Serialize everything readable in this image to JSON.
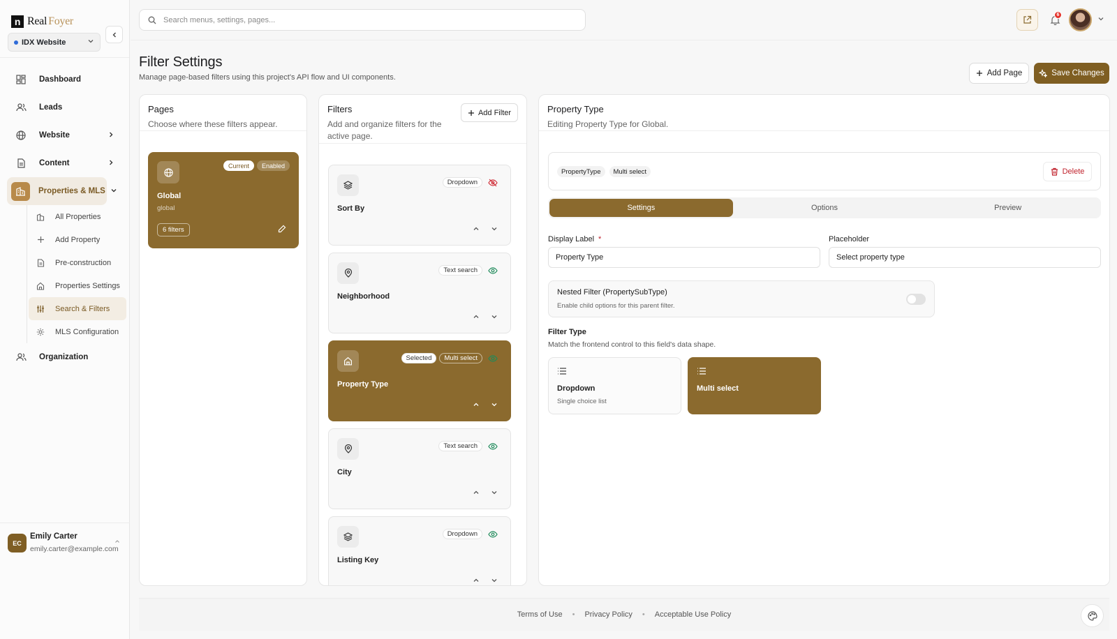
{
  "brand": {
    "logo_mark": "n",
    "name_a": "Real",
    "name_b": "Foyer"
  },
  "site_selector": {
    "value": "IDX Website"
  },
  "search": {
    "placeholder": "Search menus, settings, pages..."
  },
  "notifications": {
    "count": "6"
  },
  "nav": {
    "dashboard": "Dashboard",
    "leads": "Leads",
    "website": "Website",
    "content": "Content",
    "properties": "Properties & MLS",
    "organization": "Organization",
    "sub": {
      "all_properties": "All Properties",
      "add_property": "Add Property",
      "preconstruction": "Pre-construction",
      "properties_settings": "Properties Settings",
      "search_filters": "Search & Filters",
      "mls_configuration": "MLS Configuration"
    }
  },
  "user": {
    "initials": "EC",
    "name": "Emily Carter",
    "email": "emily.carter@example.com"
  },
  "page": {
    "title": "Filter Settings",
    "subtitle": "Manage page-based filters using this project's API flow and UI components.",
    "add_page": "Add Page",
    "save_changes": "Save Changes"
  },
  "pages_panel": {
    "title": "Pages",
    "desc": "Choose where these filters appear.",
    "card": {
      "badge_current": "Current",
      "badge_enabled": "Enabled",
      "name": "Global",
      "slug": "global",
      "count": "6 filters"
    }
  },
  "filters_panel": {
    "title": "Filters",
    "desc": "Add and organize filters for the active page.",
    "add_filter": "Add Filter",
    "items": [
      {
        "name": "Sort By",
        "type": "Dropdown",
        "selected_label": "",
        "icon": "layers-icon",
        "visible": false
      },
      {
        "name": "Neighborhood",
        "type": "Text search",
        "selected_label": "",
        "icon": "map-pin-icon",
        "visible": true
      },
      {
        "name": "Property Type",
        "type": "Multi select",
        "selected_label": "Selected",
        "icon": "home-icon",
        "visible": true
      },
      {
        "name": "City",
        "type": "Text search",
        "selected_label": "",
        "icon": "map-pin-icon",
        "visible": true
      },
      {
        "name": "Listing Key",
        "type": "Dropdown",
        "selected_label": "",
        "icon": "layers-icon",
        "visible": true
      }
    ]
  },
  "editor": {
    "title": "Property Type",
    "desc": "Editing Property Type for Global.",
    "tag_field": "PropertyType",
    "tag_type": "Multi select",
    "delete": "Delete",
    "tabs": {
      "settings": "Settings",
      "options": "Options",
      "preview": "Preview"
    },
    "display_label": {
      "label": "Display Label",
      "required_mark": "*",
      "value": "Property Type"
    },
    "placeholder": {
      "label": "Placeholder",
      "value": "Select property type"
    },
    "nested": {
      "title": "Nested Filter (PropertySubType)",
      "desc": "Enable child options for this parent filter.",
      "enabled": false
    },
    "filter_type": {
      "title": "Filter Type",
      "desc": "Match the frontend control to this field's data shape.",
      "dropdown": {
        "name": "Dropdown",
        "desc": "Single choice list"
      },
      "multi": {
        "name": "Multi select"
      }
    }
  },
  "footer": {
    "terms": "Terms of Use",
    "privacy": "Privacy Policy",
    "aup": "Acceptable Use Policy",
    "separator": "•"
  },
  "colors": {
    "accent": "#8b6a2e",
    "accent_dark": "#7f5e22",
    "danger": "#c0222c",
    "eye_green": "#1f8a5a",
    "eye_off_red": "#d0303a"
  }
}
